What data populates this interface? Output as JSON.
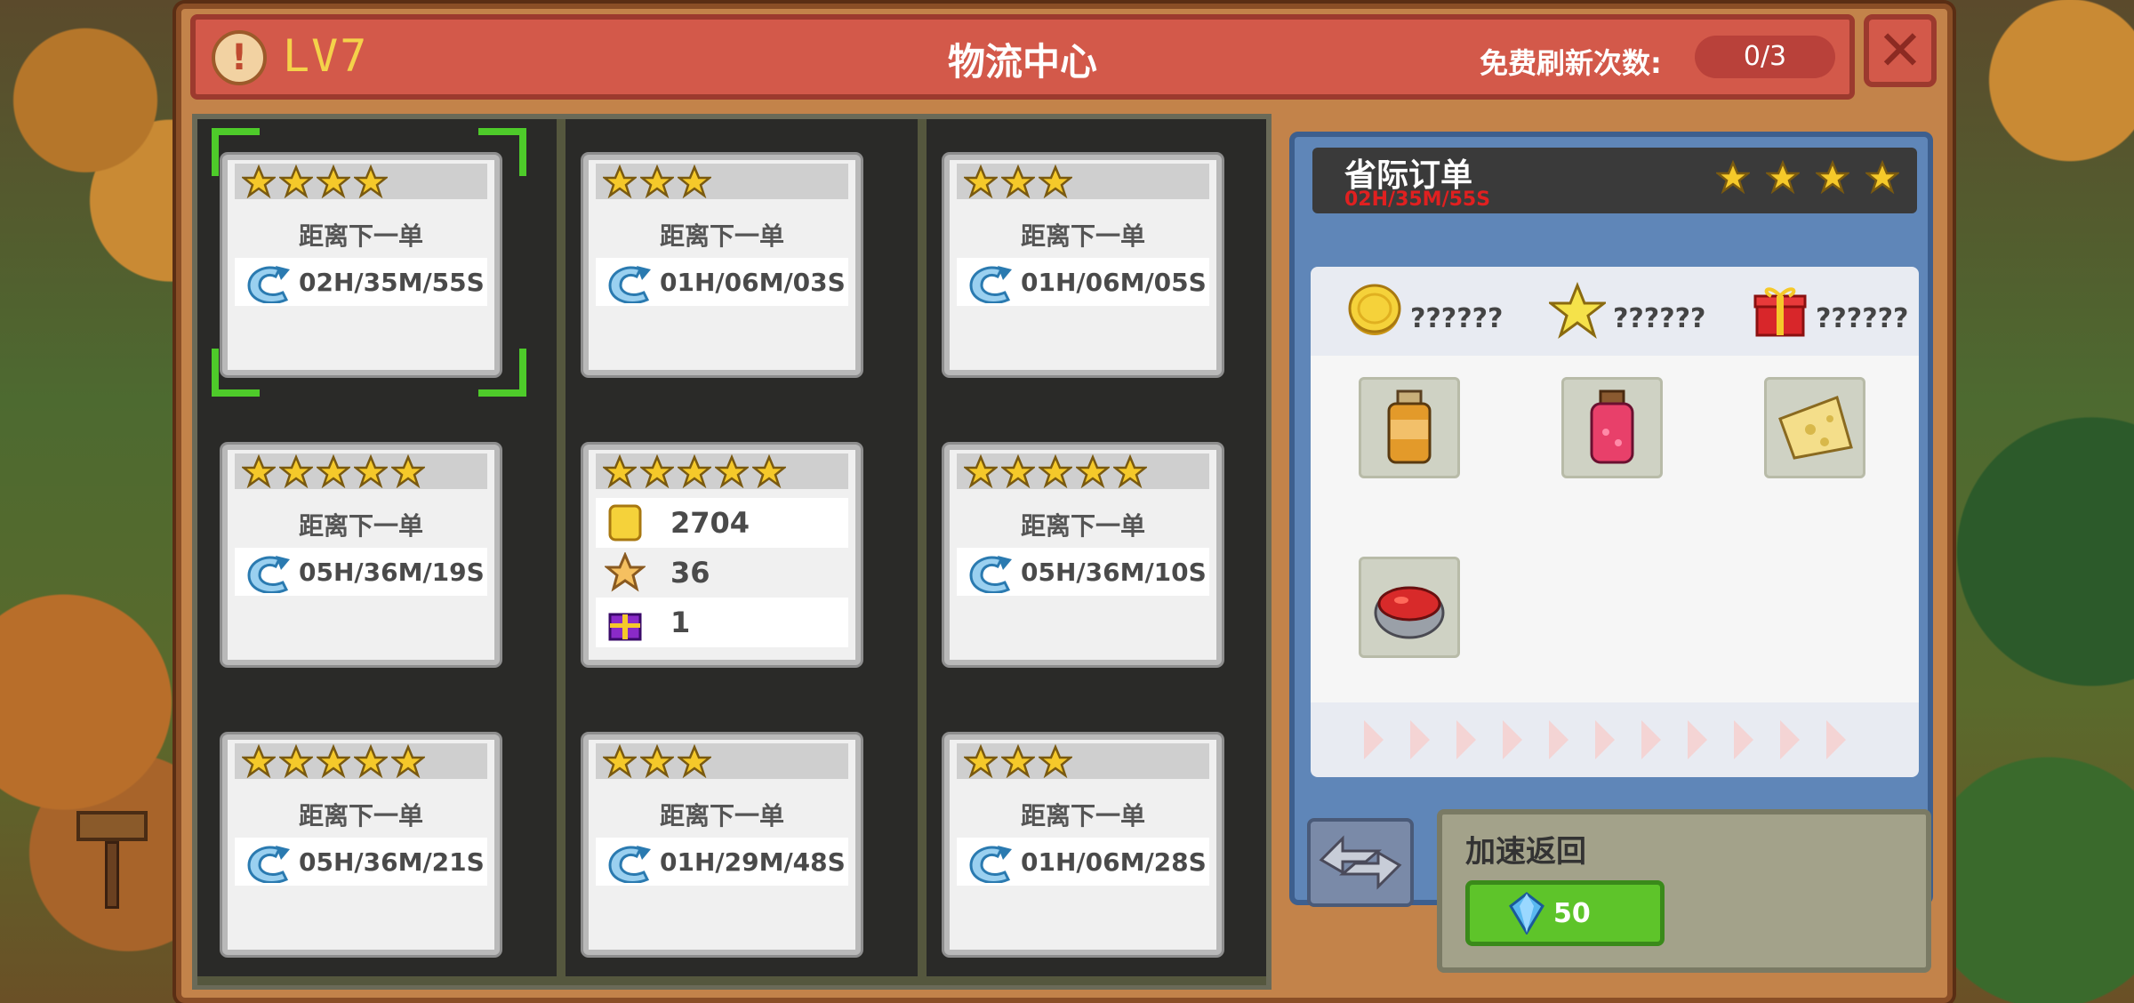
{
  "header": {
    "level": "LV7",
    "title": "物流中心",
    "refresh_label": "免费刷新次数:",
    "refresh_count": "0/3"
  },
  "orders": [
    {
      "stars": 4,
      "label": "距离下一单",
      "timer": "02H/35M/55S",
      "selected": true
    },
    {
      "stars": 3,
      "label": "距离下一单",
      "timer": "01H/06M/03S"
    },
    {
      "stars": 3,
      "label": "距离下一单",
      "timer": "01H/06M/05S"
    },
    {
      "stars": 5,
      "label": "距离下一单",
      "timer": "05H/36M/19S"
    },
    {
      "stars": 5,
      "rewards": {
        "coins": "2704",
        "stars": "36",
        "gifts": "1"
      }
    },
    {
      "stars": 5,
      "label": "距离下一单",
      "timer": "05H/36M/10S"
    },
    {
      "stars": 5,
      "label": "距离下一单",
      "timer": "05H/36M/21S"
    },
    {
      "stars": 3,
      "label": "距离下一单",
      "timer": "01H/29M/48S"
    },
    {
      "stars": 3,
      "label": "距离下一单",
      "timer": "01H/06M/28S"
    }
  ],
  "detail": {
    "title": "省际订单",
    "timer": "02H/35M/55S",
    "stars": 4,
    "reward_coins": "??????",
    "reward_stars": "??????",
    "reward_gifts": "??????",
    "items": [
      "honey-jar-icon",
      "jam-jar-icon",
      "cheese-icon",
      "tomato-soup-icon"
    ]
  },
  "speedup": {
    "title": "加速返回",
    "cost": "50"
  },
  "colors": {
    "header_red": "#d3594a",
    "star_gold": "#f5c92a",
    "selected_green": "#4ecb2a",
    "speed_green": "#5ec42a",
    "detail_blue": "#5f86b8",
    "timer_red": "#e02020"
  }
}
